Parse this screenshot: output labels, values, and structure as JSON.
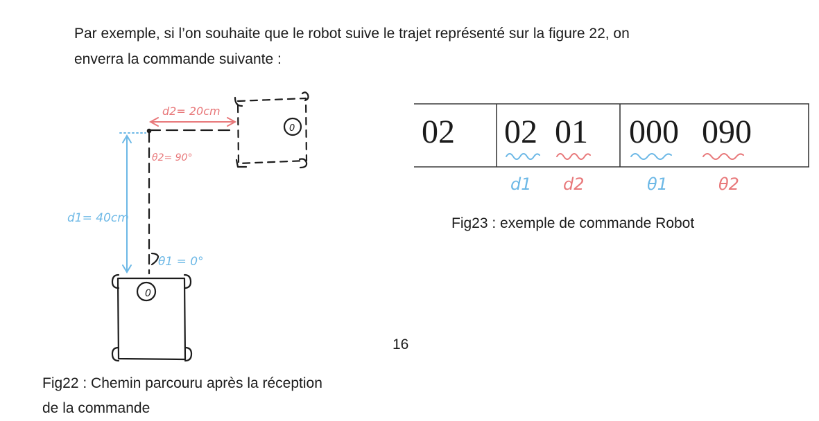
{
  "intro": {
    "line1": "Par exemple, si l’on souhaite que le robot suive le trajet représenté sur la figure 22, on",
    "line2": "enverra la commande suivante :"
  },
  "figure22": {
    "label_d2": "d2= 20cm",
    "label_theta2": "θ2= 90°",
    "label_d1": "d1= 40cm",
    "label_theta1": "θ1 = 0°",
    "robot_mark": "0",
    "caption_line1": "Fig22 : Chemin parcouru après la réception",
    "caption_line2": "de la commande"
  },
  "figure23": {
    "cells": [
      "02",
      "02 01",
      "000 090"
    ],
    "cell1_a": "02",
    "cell1_b": "01",
    "cell2_a": "000",
    "cell2_b": "090",
    "annotation_d1": "d1",
    "annotation_d2": "d2",
    "annotation_theta1": "θ1",
    "annotation_theta2": "θ2",
    "caption": "Fig23 : exemple de commande Robot"
  },
  "page_number": "16",
  "colors": {
    "text": "#1b1b1b",
    "blue_annotation": "#6cb8e6",
    "red_annotation": "#e8787a",
    "sketch": "#1c1c1c"
  }
}
